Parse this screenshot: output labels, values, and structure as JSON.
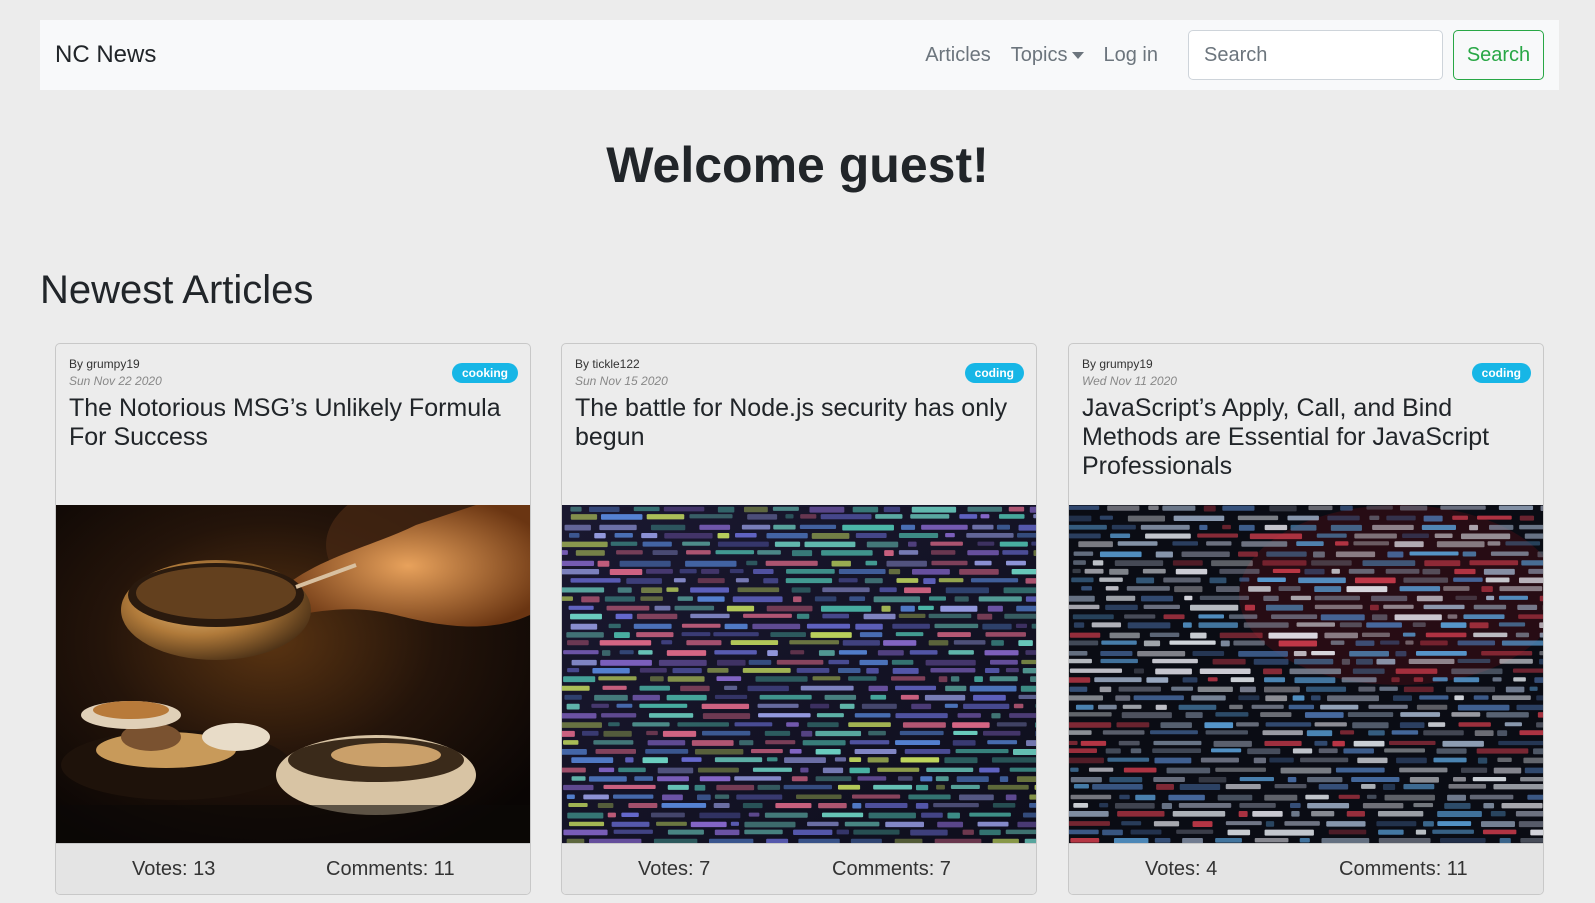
{
  "navbar": {
    "brand": "NC News",
    "links": {
      "articles": "Articles",
      "topics": "Topics",
      "login": "Log in"
    },
    "search_placeholder": "Search",
    "search_button": "Search"
  },
  "welcome": "Welcome guest!",
  "section_title": "Newest Articles",
  "articles": [
    {
      "author": "By grumpy19",
      "date": "Sun Nov 22 2020",
      "topic": "cooking",
      "title": "The Notorious MSG’s Unlikely Formula For Success",
      "votes": "Votes: 13",
      "comments": "Comments: 11",
      "image_icon": "cooking-photo"
    },
    {
      "author": "By tickle122",
      "date": "Sun Nov 15 2020",
      "topic": "coding",
      "title": "The battle for Node.js security has only begun",
      "votes": "Votes: 7",
      "comments": "Comments: 7",
      "image_icon": "code-screen-photo"
    },
    {
      "author": "By grumpy19",
      "date": "Wed Nov 11 2020",
      "topic": "coding",
      "title": "JavaScript’s Apply, Call, and Bind Methods are Essential for JavaScript Professionals",
      "votes": "Votes: 4",
      "comments": "Comments: 11",
      "image_icon": "code-screen-photo"
    }
  ],
  "colors": {
    "badge": "#17b6e6",
    "search_button": "#28a745",
    "background": "#ececec"
  }
}
